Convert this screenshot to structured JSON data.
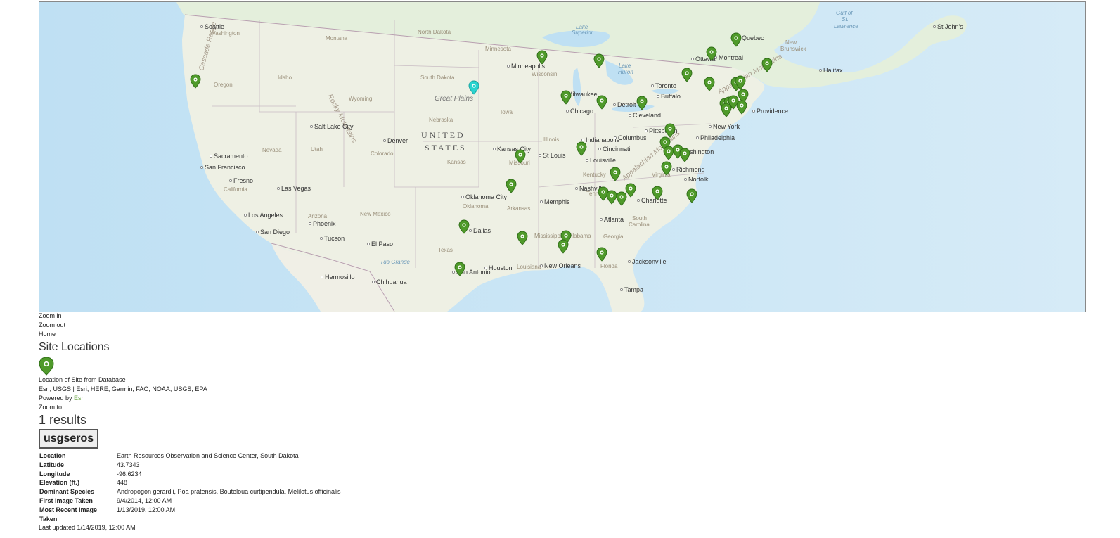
{
  "map": {
    "country_label": [
      "UNITED",
      "STATES"
    ],
    "cities": [
      [
        "Seattle",
        290,
        40
      ],
      [
        "Salt Lake City",
        446,
        182
      ],
      [
        "Sacramento",
        303,
        224
      ],
      [
        "San Francisco",
        290,
        240
      ],
      [
        "Fresno",
        331,
        259
      ],
      [
        "Las Vegas",
        399,
        270
      ],
      [
        "Los Angeles",
        352,
        308
      ],
      [
        "San Diego",
        369,
        332
      ],
      [
        "Phoenix",
        444,
        320
      ],
      [
        "Tucson",
        460,
        341
      ],
      [
        "El Paso",
        527,
        349
      ],
      [
        "Hermosillo",
        461,
        396
      ],
      [
        "Chihuahua",
        534,
        403
      ],
      [
        "Denver",
        550,
        202
      ],
      [
        "Oklahoma City",
        661,
        282
      ],
      [
        "Dallas",
        672,
        330
      ],
      [
        "San Antonio",
        648,
        389
      ],
      [
        "Houston",
        694,
        383
      ],
      [
        "Kansas City",
        706,
        214
      ],
      [
        "St Louis",
        771,
        223
      ],
      [
        "Minneapolis",
        726,
        96
      ],
      [
        "Milwaukee",
        806,
        136
      ],
      [
        "Chicago",
        810,
        160
      ],
      [
        "Memphis",
        773,
        289
      ],
      [
        "New Orleans",
        773,
        380
      ],
      [
        "Nashville",
        823,
        270
      ],
      [
        "Louisville",
        838,
        230
      ],
      [
        "Indianapolis",
        832,
        201
      ],
      [
        "Cincinnati",
        856,
        214
      ],
      [
        "Columbus",
        878,
        198
      ],
      [
        "Detroit",
        877,
        151
      ],
      [
        "Cleveland",
        899,
        166
      ],
      [
        "Toronto",
        931,
        124
      ],
      [
        "Buffalo",
        939,
        139
      ],
      [
        "Pittsburgh",
        922,
        188
      ],
      [
        "Ottawa",
        988,
        86
      ],
      [
        "Montreal",
        1021,
        84
      ],
      [
        "Quebec",
        1054,
        56
      ],
      [
        "New York",
        1013,
        182
      ],
      [
        "Philadelphia",
        995,
        198
      ],
      [
        "Washington",
        967,
        218
      ],
      [
        "Richmond",
        961,
        243
      ],
      [
        "Norfolk",
        978,
        257
      ],
      [
        "Charlotte",
        911,
        287
      ],
      [
        "Atlanta",
        858,
        314
      ],
      [
        "Jacksonville",
        898,
        374
      ],
      [
        "Tampa",
        887,
        414
      ],
      [
        "Providence",
        1075,
        160
      ],
      [
        "Halifax",
        1170,
        102
      ],
      [
        "St John's",
        1332,
        40
      ]
    ],
    "regions": [
      [
        "Washington",
        298,
        49
      ],
      [
        "Montana",
        462,
        56
      ],
      [
        "North Dakota",
        593,
        47
      ],
      [
        "Minnesota",
        689,
        71
      ],
      [
        "Oregon",
        303,
        122
      ],
      [
        "Idaho",
        394,
        112
      ],
      [
        "Wyoming",
        495,
        142
      ],
      [
        "South Dakota",
        597,
        112
      ],
      [
        "Wisconsin",
        755,
        107
      ],
      [
        "Nebraska",
        609,
        172
      ],
      [
        "Iowa",
        711,
        161
      ],
      [
        "Illinois",
        772,
        200
      ],
      [
        "Nevada",
        372,
        215
      ],
      [
        "Utah",
        441,
        214
      ],
      [
        "Colorado",
        526,
        220
      ],
      [
        "Kansas",
        635,
        232
      ],
      [
        "Missouri",
        723,
        233
      ],
      [
        "Kentucky",
        828,
        250
      ],
      [
        "Virginia",
        926,
        250
      ],
      [
        "California",
        317,
        271
      ],
      [
        "Arizona",
        437,
        309
      ],
      [
        "New Mexico",
        511,
        306
      ],
      [
        "Oklahoma",
        657,
        295
      ],
      [
        "Arkansas",
        720,
        298
      ],
      [
        "Tennessee",
        833,
        277
      ],
      [
        "Mississippi",
        759,
        337
      ],
      [
        "Alabama",
        808,
        337
      ],
      [
        "Georgia",
        857,
        338
      ],
      [
        "South",
        898,
        312
      ],
      [
        "Carolina",
        893,
        321
      ],
      [
        "Texas",
        622,
        357
      ],
      [
        "Louisiana",
        734,
        381
      ],
      [
        "Florida",
        853,
        380
      ],
      [
        "New",
        1116,
        62
      ],
      [
        "Brunswick",
        1109,
        71
      ]
    ],
    "water": [
      [
        "Gulf of",
        1188,
        20
      ],
      [
        "St.",
        1196,
        29
      ],
      [
        "Lawrence",
        1185,
        39
      ],
      [
        "Lake",
        818,
        40
      ],
      [
        "Superior",
        812,
        48
      ],
      [
        "Lake",
        879,
        95
      ],
      [
        "Huron",
        878,
        104
      ],
      [
        "Rio Grande",
        541,
        374
      ]
    ],
    "mountains": [
      [
        "Rocky Mountains",
        465,
        135,
        62
      ],
      [
        "Appalachian Mountains",
        1022,
        133,
        -30
      ],
      [
        "Appalachian Mountains",
        887,
        256,
        -40
      ],
      [
        "Cascade Range",
        288,
        100,
        -75
      ]
    ],
    "plains": [
      "Great Plains",
      617,
      142
    ],
    "markers": [
      [
        277,
        116
      ],
      [
        770,
        82
      ],
      [
        851,
        87
      ],
      [
        804,
        139
      ],
      [
        855,
        146
      ],
      [
        912,
        147
      ],
      [
        1046,
        57
      ],
      [
        1011,
        77
      ],
      [
        1090,
        93
      ],
      [
        976,
        107
      ],
      [
        1008,
        120
      ],
      [
        1046,
        120
      ],
      [
        1052,
        118
      ],
      [
        1056,
        137
      ],
      [
        1030,
        150
      ],
      [
        1036,
        148
      ],
      [
        1042,
        146
      ],
      [
        1032,
        157
      ],
      [
        1054,
        153
      ],
      [
        952,
        186
      ],
      [
        826,
        212
      ],
      [
        945,
        205
      ],
      [
        950,
        218
      ],
      [
        963,
        216
      ],
      [
        973,
        221
      ],
      [
        739,
        223
      ],
      [
        947,
        240
      ],
      [
        874,
        248
      ],
      [
        726,
        265
      ],
      [
        896,
        271
      ],
      [
        934,
        275
      ],
      [
        857,
        276
      ],
      [
        869,
        281
      ],
      [
        883,
        283
      ],
      [
        983,
        279
      ],
      [
        659,
        323
      ],
      [
        742,
        339
      ],
      [
        804,
        338
      ],
      [
        800,
        351
      ],
      [
        855,
        362
      ],
      [
        653,
        383
      ]
    ],
    "selected_marker": [
      673,
      125
    ]
  },
  "controls": {
    "zoom_in": "Zoom in",
    "zoom_out": "Zoom out",
    "home": "Home"
  },
  "legend": {
    "title": "Site Locations",
    "item_label": "Location of Site from Database"
  },
  "attribution": "Esri, USGS | Esri, HERE, Garmin, FAO, NOAA, USGS, EPA",
  "powered_by": {
    "prefix": "Powered by ",
    "link": "Esri"
  },
  "zoom_to": "Zoom to",
  "results_count": "1 results",
  "site": {
    "id": "usgseros",
    "fields": [
      {
        "label": "Location",
        "value": "Earth Resources Observation and Science Center, South Dakota"
      },
      {
        "label": "Latitude",
        "value": "43.7343"
      },
      {
        "label": "Longitude",
        "value": "-96.6234"
      },
      {
        "label": "Elevation (ft.)",
        "value": "448"
      },
      {
        "label": "Dominant Species",
        "value": "Andropogon gerardii, Poa pratensis, Bouteloua curtipendula, Melilotus officinalis"
      },
      {
        "label": "First Image Taken",
        "value": "9/4/2014, 12:00 AM"
      },
      {
        "label": "Most Recent Image Taken",
        "value": "1/13/2019, 12:00 AM"
      }
    ],
    "last_updated": "Last updated 1/14/2019, 12:00 AM"
  },
  "colors": {
    "marker": "#4f9a2a",
    "marker_selected": "#2ad3cf",
    "ocean": "#cfe6f5",
    "land": "#eef0e6",
    "canada": "#e2eedc",
    "link": "#6aa544"
  }
}
